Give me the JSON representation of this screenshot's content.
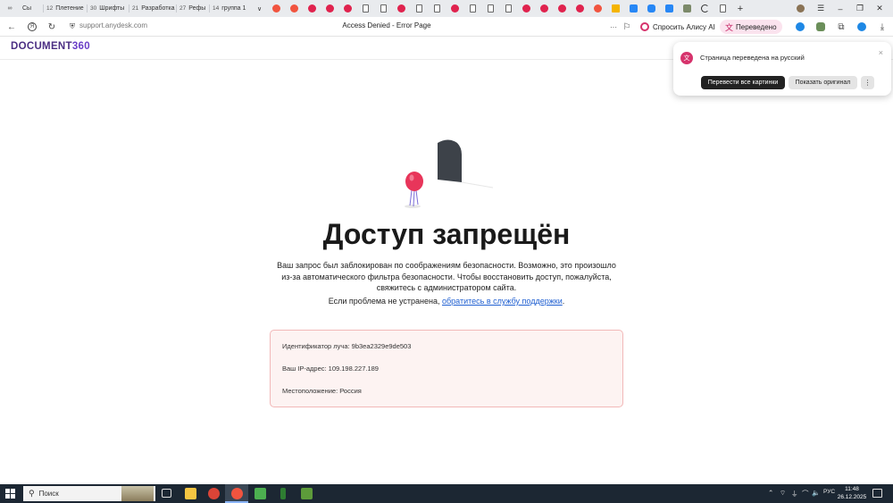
{
  "browser": {
    "tabs": [
      {
        "count": "",
        "label": "Сы"
      },
      {
        "count": "12",
        "label": "Плетение"
      },
      {
        "count": "30",
        "label": "Шрифты"
      },
      {
        "count": "21",
        "label": "Разработка"
      },
      {
        "count": "27",
        "label": "Рефы"
      },
      {
        "count": "14",
        "label": "группа 1"
      }
    ],
    "overflow_label": "∨",
    "favicons": [
      "yandex-icon",
      "yandex-icon",
      "pinterest-icon",
      "pinterest-icon",
      "pinterest-icon",
      "document-icon",
      "document-icon",
      "pinterest-icon",
      "document-icon",
      "document-icon",
      "pinterest-icon",
      "document-icon",
      "document-icon",
      "document-icon",
      "pinterest-icon",
      "pinterest-icon",
      "pinterest-icon",
      "pinterest-icon",
      "yandex-icon",
      "image-icon",
      "vk-icon",
      "messenger-icon",
      "vk-icon",
      "extension-icon",
      "loading-icon",
      "document-icon"
    ],
    "new_tab": "+",
    "url": "support.anydesk.com",
    "page_title": "Access Denied - Error Page",
    "more_label": "···",
    "alice_label": "Спросить Алису AI",
    "translated_label": "Переведено"
  },
  "site": {
    "logo_text": "DOCUMENT",
    "logo_num": "360"
  },
  "translate_popup": {
    "text": "Страница переведена на русский",
    "translate_images": "Перевести все картинки",
    "show_original": "Показать оригинал",
    "more": "⋮",
    "close": "×"
  },
  "page": {
    "heading": "Доступ запрещён",
    "message": "Ваш запрос был заблокирован по соображениям безопасности. Возможно, это произошло из-за автоматического фильтра безопасности. Чтобы восстановить доступ, пожалуйста, свяжитесь с администратором сайта.",
    "help_prefix": "Если проблема не устранена, ",
    "help_link": "обратитесь в службу поддержки",
    "help_suffix": ".",
    "ray_id": "Идентификатор луча: 9b3ea2329e9de503",
    "ip": "Ваш IP-адрес: 109.198.227.189",
    "location": "Местоположение: Россия"
  },
  "taskbar": {
    "search_placeholder": "Поиск",
    "lang": "РУС",
    "time": "11:48",
    "date": "26.12.2025"
  },
  "colors": {
    "accent_purple": "#4b2e83",
    "link_blue": "#1f5fd1",
    "error_border": "#f2b8b8",
    "error_bg": "#fdf3f2",
    "balloon": "#e8355a"
  }
}
